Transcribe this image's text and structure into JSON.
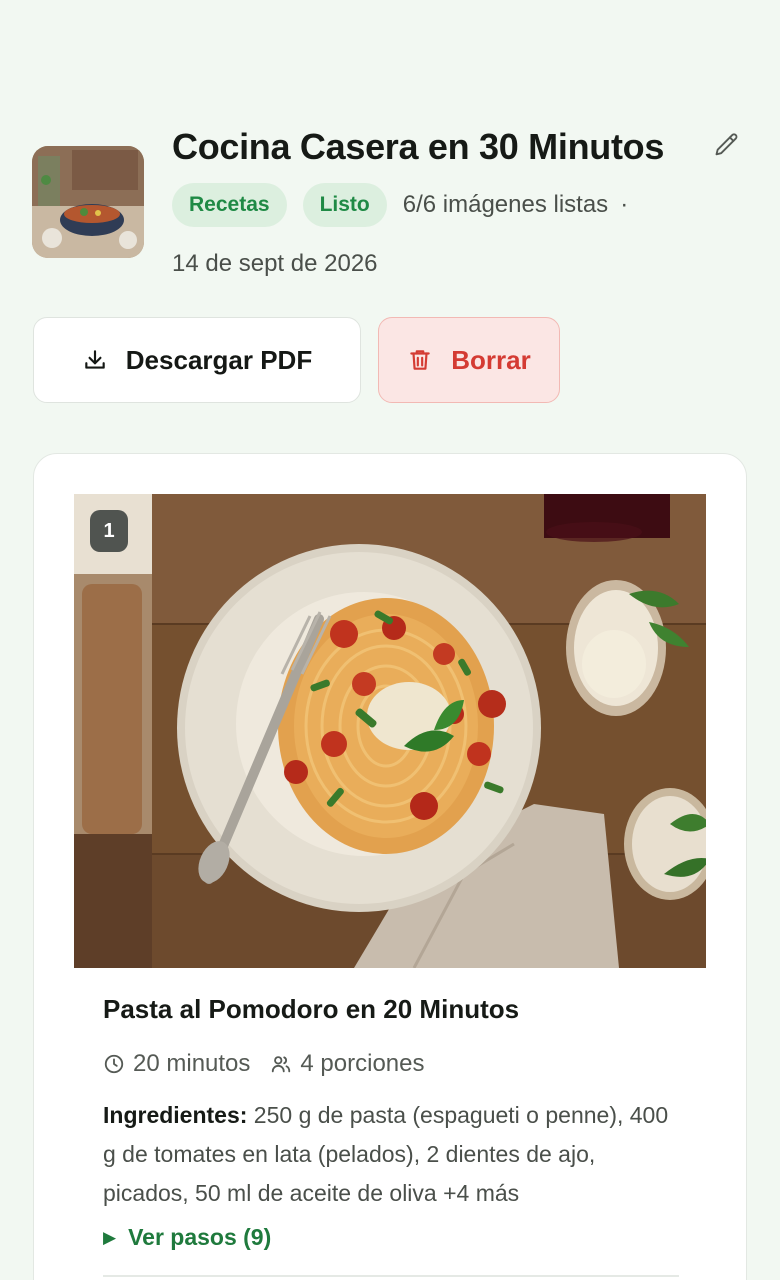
{
  "collection": {
    "title": "Cocina Casera en 30 Minutos",
    "category_badge": "Recetas",
    "status_badge": "Listo",
    "images_status": "6/6 imágenes listas",
    "separator": "·",
    "date": "14 de sept de 2026"
  },
  "actions": {
    "download_label": "Descargar PDF",
    "delete_label": "Borrar"
  },
  "recipe": {
    "index": "1",
    "title": "Pasta al Pomodoro en 20 Minutos",
    "time": "20 minutos",
    "servings": "4 porciones",
    "ingredients_label": "Ingredientes:",
    "ingredients_text": " 250 g de pasta (espagueti o penne), 400 g de tomates en lata (pelados), 2 dientes de ajo, picados, 50 ml de aceite de oliva +4 más",
    "steps_toggle": "Ver pasos (9)"
  },
  "icons": {
    "edit": "pencil-icon",
    "download": "download-icon",
    "delete": "trash-icon",
    "time": "clock-icon",
    "servings": "users-icon",
    "toggle": "triangle-right-icon"
  },
  "colors": {
    "background": "#f2f8f2",
    "accent_green": "#1f8a45",
    "badge_green_bg": "#dcefdf",
    "danger": "#d43b33",
    "danger_bg": "#fbe6e4"
  }
}
